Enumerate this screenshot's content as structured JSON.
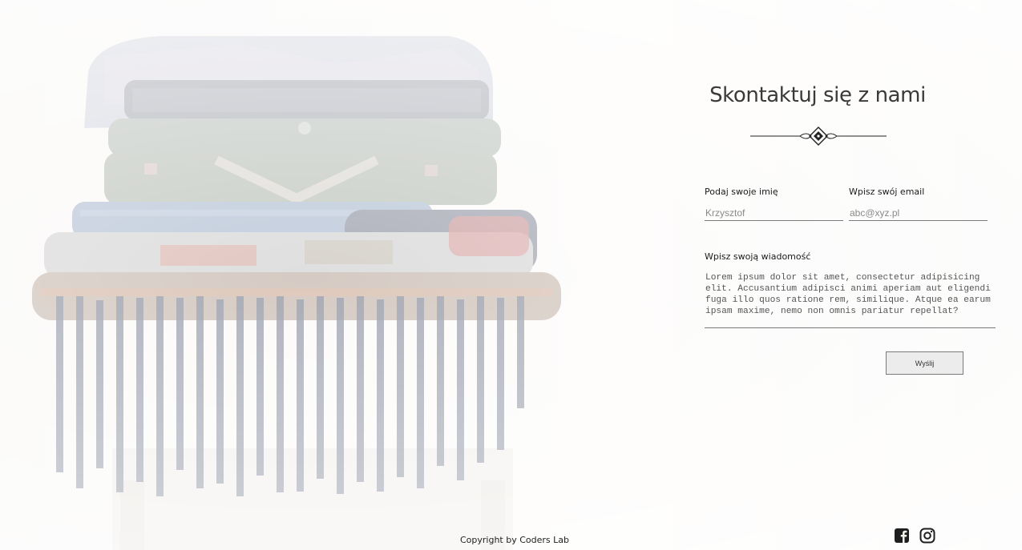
{
  "contact": {
    "title": "Skontaktuj się z nami",
    "name_label": "Podaj swoje imię",
    "name_placeholder": "Krzysztof",
    "email_label": "Wpisz swój email",
    "email_placeholder": "abc@xyz.pl",
    "message_label": "Wpisz swoją wiadomość",
    "message_value": "Lorem ipsum dolor sit amet, consectetur adipisicing elit. Accusantium adipisci animi aperiam aut eligendi fuga illo quos ratione rem, similique. Atque ea earum ipsam maxime, nemo non omnis pariatur repellat?",
    "send_label": "Wyślij"
  },
  "footer": {
    "copyright": "Copyright by Coders Lab",
    "social": [
      {
        "name": "facebook-icon"
      },
      {
        "name": "instagram-icon"
      }
    ]
  },
  "colors": {
    "background": "#faf8f5",
    "title": "#3a3a3a",
    "underline": "#7a7a7a",
    "button_bg": "#ececec"
  }
}
